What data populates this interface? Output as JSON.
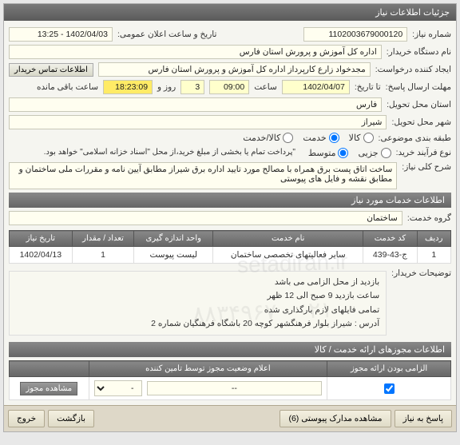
{
  "panel_title": "جزئیات اطلاعات نیاز",
  "form": {
    "need_number_label": "شماره نیاز:",
    "need_number": "1102003679000120",
    "announce_date_label": "تاریخ و ساعت اعلان عمومی:",
    "announce_date": "1402/04/03 - 13:25",
    "device_name_label": "نام دستگاه خریدار:",
    "device_name": "اداره کل آموزش و پرورش استان فارس",
    "requester_label": "ایجاد کننده درخواست:",
    "requester": "مجدخواد زارع کارپرداز اداره کل آموزش و پرورش استان فارس",
    "contact_btn": "اطلاعات تماس خریدار",
    "deadline_label": "مهلت ارسال پاسخ:",
    "to_date_label": "تا تاریخ:",
    "deadline_date": "1402/04/07",
    "time_label": "ساعت",
    "deadline_time": "09:00",
    "day_label": "روز و",
    "days_left": "3",
    "countdown": "18:23:09",
    "remaining_label": "ساعت باقی مانده",
    "delivery_province_label": "استان محل تحویل:",
    "delivery_province": "فارس",
    "delivery_city_label": "شهر محل تحویل:",
    "delivery_city": "شیراز",
    "category_label": "طبقه بندی موضوعی:",
    "cat_options": {
      "goods": "کالا",
      "service": "خدمت",
      "both": "کالا/خدمت"
    },
    "process_label": "نوع فرآیند خرید:",
    "proc_options": {
      "small": "جزیی",
      "medium": "متوسط"
    },
    "process_note": "\"پرداخت تمام یا بخشی از مبلغ خرید،از محل \"اسناد خزانه اسلامی\" خواهد بود.",
    "keyword_label": "شرح کلی نیاز:",
    "keyword_text": "ساخت اتاق پست برق همراه با مصالح مورد تایید اداره برق شیراز مطابق آیین نامه و مقررات ملی ساختمان و مطابق نقشه و فایل های پیوستی"
  },
  "services_header": "اطلاعات خدمات مورد نیاز",
  "service_group_label": "گروه خدمت:",
  "service_group": "ساختمان",
  "table": {
    "headers": [
      "ردیف",
      "کد خدمت",
      "نام خدمت",
      "واحد اندازه گیری",
      "تعداد / مقدار",
      "تاریخ نیاز"
    ],
    "row": [
      "1",
      "ج-43-439",
      "سایر فعالیتهای تخصصی ساختمان",
      "لیست پیوست",
      "1",
      "1402/04/13"
    ]
  },
  "buyer_notes_label": "توضیحات خریدار:",
  "buyer_notes_lines": [
    "بازدید از محل الزامی می باشد",
    "ساعت بازدید 9 صبح الی 12 ظهر",
    "تمامی فایلهای لازم بارگذاری شده",
    "آدرس : شیراز  بلوار فرهنگشهر کوچه 20 باشگاه فرهنگیان شماره 2"
  ],
  "auth_header": "اطلاعات مجوزهای ارائه خدمت / کالا",
  "auth_table": {
    "col_mandatory": "الزامی بودن ارائه مجوز",
    "col_status": "اعلام وضعیت مجوز توسط تامین کننده",
    "dash": "--",
    "view_btn": "مشاهده مجوز"
  },
  "bottom": {
    "reply": "پاسخ به نیاز",
    "attachments": "مشاهده مدارک پیوستی (6)",
    "back": "بازگشت",
    "exit": "خروج"
  },
  "watermark1": "setadiran.ir",
  "watermark2": "۰۲۱ - ۸۸۳۴۹۶۷"
}
